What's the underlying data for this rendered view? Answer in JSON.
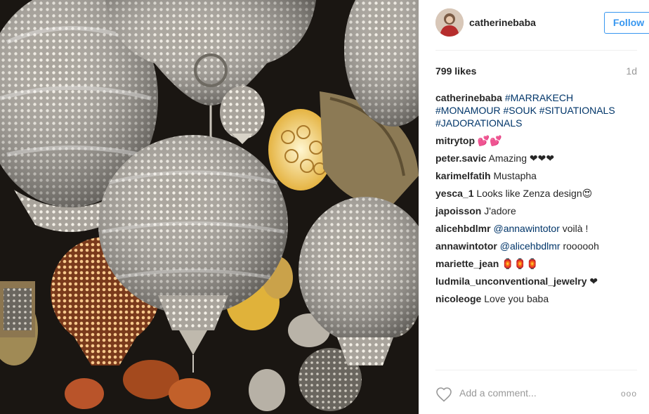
{
  "post": {
    "username": "catherinebaba",
    "follow_label": "Follow",
    "likes": "799 likes",
    "age": "1d",
    "caption": {
      "user": "catherinebaba",
      "hashtags": "#MARRAKECH #MONAMOUR #SOUK #SITUATIONALS #JADORATIONALS"
    },
    "comments": [
      {
        "user": "mitrytop",
        "mention": "",
        "text": "💕💕"
      },
      {
        "user": "peter.savic",
        "mention": "",
        "text": "Amazing ❤❤❤"
      },
      {
        "user": "karimelfatih",
        "mention": "",
        "text": "Mustapha"
      },
      {
        "user": "yesca_1",
        "mention": "",
        "text": "Looks like Zenza design😍"
      },
      {
        "user": "japoisson",
        "mention": "",
        "text": "J'adore"
      },
      {
        "user": "alicehbdlmr",
        "mention": "@annawintotor",
        "text": "voilà !"
      },
      {
        "user": "annawintotor",
        "mention": "@alicehbdlmr",
        "text": "roooooh"
      },
      {
        "user": "mariette_jean",
        "mention": "",
        "text": "🏮🏮🏮"
      },
      {
        "user": "ludmila_unconventional_jewelry",
        "mention": "",
        "text": "❤"
      },
      {
        "user": "nicoleoge",
        "mention": "",
        "text": "Love you baba"
      }
    ],
    "add_comment_placeholder": "Add a comment...",
    "more_options": "ooo"
  },
  "icons": {
    "like": "heart-icon",
    "more": "more-options-icon",
    "avatar": "avatar"
  },
  "colors": {
    "follow_blue": "#3897f0",
    "hashtag_blue": "#003569",
    "muted_gray": "#999999",
    "separator": "#efefef"
  }
}
